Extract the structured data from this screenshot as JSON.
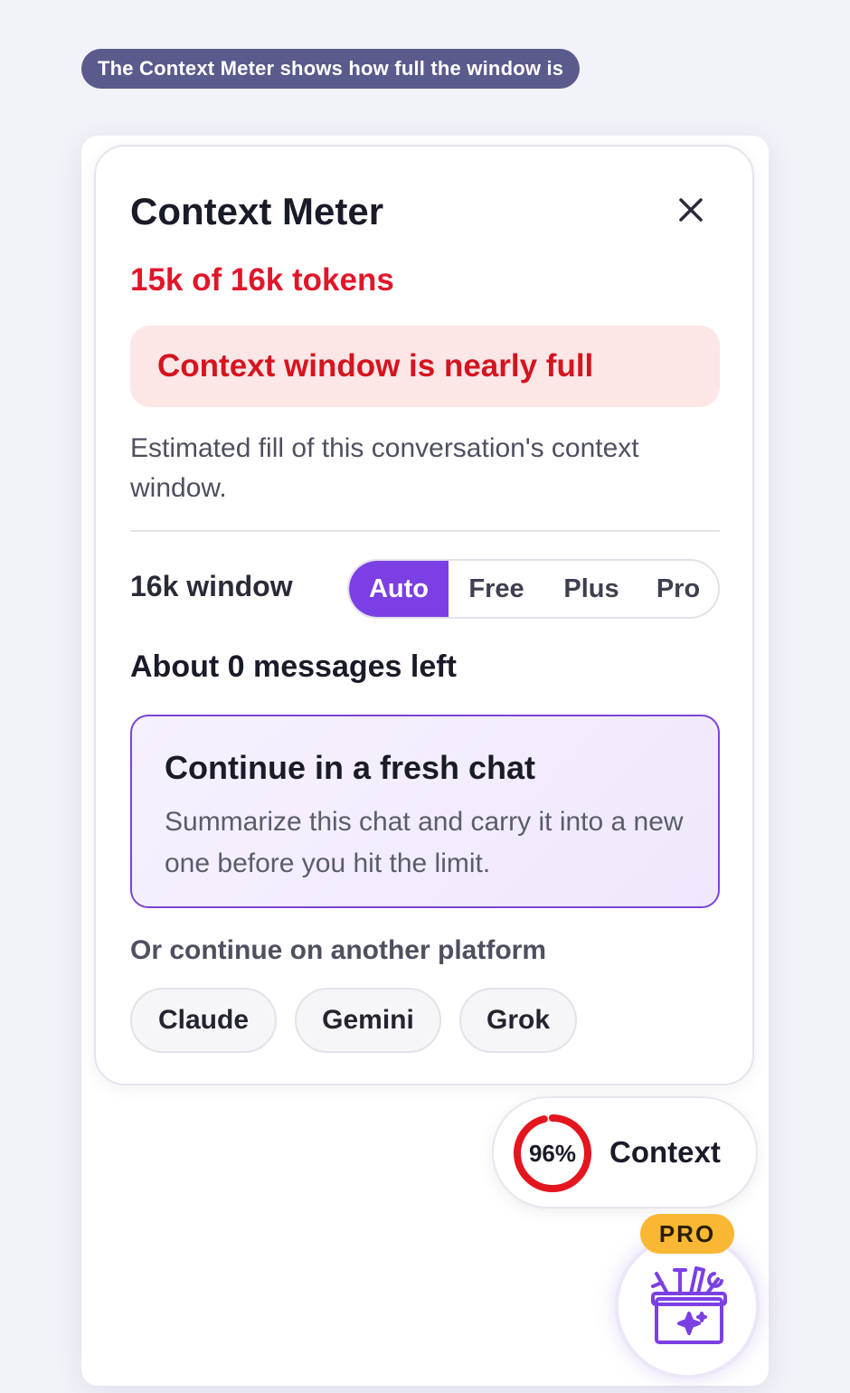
{
  "caption": "The Context Meter shows how full the window is",
  "panel": {
    "title": "Context Meter",
    "tokens": "15k of 16k tokens",
    "warning": "Context window is nearly full",
    "description": "Estimated fill of this conversation's context window.",
    "window_label": "16k window",
    "plan_options": [
      "Auto",
      "Free",
      "Plus",
      "Pro"
    ],
    "selected_plan": "Auto",
    "messages_left": "About 0 messages left",
    "fresh_chat": {
      "title": "Continue in a fresh chat",
      "description": "Summarize this chat and carry it into a new one before you hit the limit."
    },
    "alt_label": "Or continue on another platform",
    "platforms": [
      "Claude",
      "Gemini",
      "Grok"
    ]
  },
  "context_button": {
    "percent_text": "96%",
    "fill_fraction": 0.96,
    "label": "Context"
  },
  "pro_badge": "PRO",
  "colors": {
    "accent": "#7b3fe4",
    "danger": "#e0172a",
    "warning_bg": "#fde6e6",
    "pro": "#f9b734"
  },
  "icons": {
    "close": "close-icon",
    "tools": "toolbox-icon"
  }
}
